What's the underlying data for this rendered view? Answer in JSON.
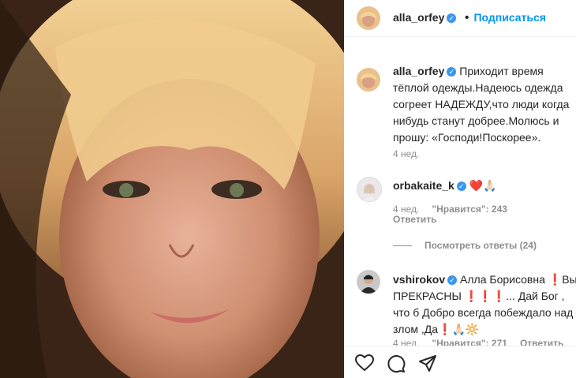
{
  "post": {
    "author": "alla_orfey",
    "follow_label": "Подписаться",
    "dot": "•"
  },
  "caption": {
    "username": "alla_orfey",
    "text": "Приходит время тёплой одежды.Надеюсь одежда согреет НАДЕЖДУ,что люди когда нибудь станут добрее.Молюсь и прошу: «Господи!Поскорее».",
    "time": "4 нед."
  },
  "comments": [
    {
      "username": "orbakaite_k",
      "text": "❤️🙏🏻",
      "time": "4 нед.",
      "likes": "\"Нравится\": 243",
      "reply": "Ответить",
      "view_replies": "Посмотреть ответы (24)"
    },
    {
      "username": "vshirokov",
      "text_part1": "Алла Борисовна",
      "text_part2": "❗Вы ПРЕКРАСНЫ ❗❗❗... Дай Бог , что б Добро всегда побеждало над злом ,Да❗🙏🏻🔆",
      "time": "4 нед.",
      "likes": "\"Нравится\": 271",
      "reply": "Ответить"
    }
  ],
  "actions": {
    "like_icon": "heart-icon",
    "comment_icon": "comment-icon",
    "share_icon": "share-icon"
  }
}
